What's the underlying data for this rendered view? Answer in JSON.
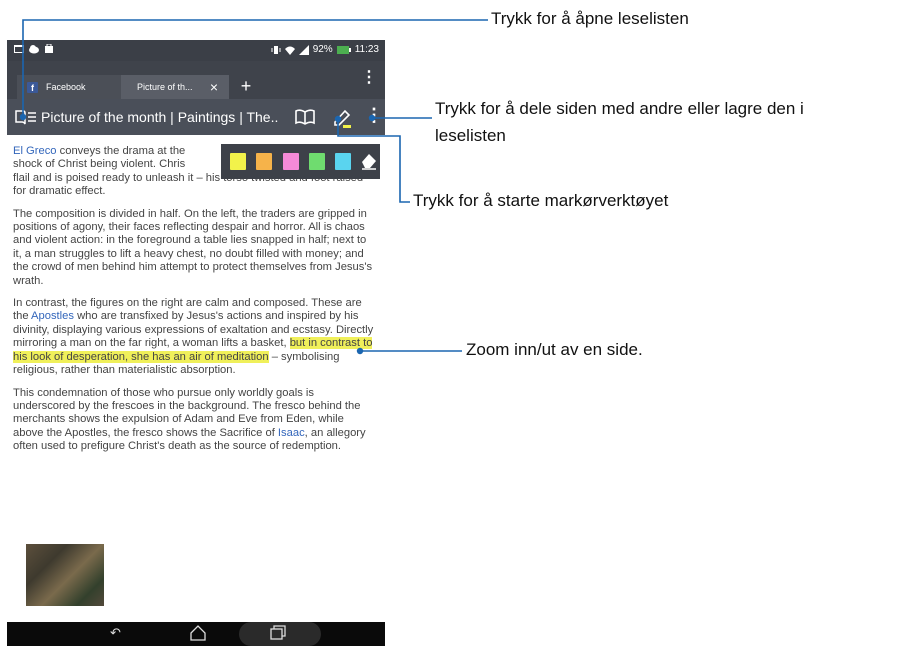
{
  "status": {
    "battery": "92%",
    "time": "11:23"
  },
  "tabs": [
    {
      "label": "Facebook",
      "icon": "f"
    },
    {
      "label": "Picture of th..."
    }
  ],
  "newtab_label": "+",
  "toolbar": {
    "title": "Picture of the month | Paintings | The...",
    "overflow": "⋮"
  },
  "article": {
    "p1a": "El Greco",
    "p1b": " conveys the drama at the ",
    "p1c": "shock of Christ being violent. Chris",
    "p1d": "flail and is poised ready to unleash it – his torso twisted and foot raised for dramatic effect.",
    "p2": "The composition is divided in half. On the left, the traders are gripped in positions of agony, their faces reflecting despair and horror. All is chaos and violent action: in the foreground a table lies snapped in half; next to it, a man struggles to lift a heavy chest, no doubt filled with money; and the crowd of men behind him attempt to protect themselves from Jesus's wrath.",
    "p3a": "In contrast, the figures on the right are calm and composed. These are the ",
    "p3b": "Apostles",
    "p3c": " who are transfixed by Jesus's actions and inspired by his divinity, displaying various expressions of exaltation and ecstasy. Directly mirroring a man on the far right, a woman lifts a basket, ",
    "p3d": "but in contrast to his look of desperation, she has an air of meditation",
    "p3e": " – symbolising religious, rather than materialistic absorption.",
    "p4a": "This condemnation of those who pursue only worldly goals is underscored by the frescoes in the background. The fresco behind the merchants shows the expulsion of Adam and Eve from Eden, while above the Apostles, the fresco shows the Sacrifice of ",
    "p4b": "Isaac",
    "p4c": ", an allegory often used to prefigure Christ's death as the source of redemption."
  },
  "palette_colors": [
    "#f2f24a",
    "#f6b34a",
    "#f58ad8",
    "#6fdc6f",
    "#5ad4ef"
  ],
  "callouts": {
    "reading_list": "Trykk for å åpne leselisten",
    "share_line1": "Trykk for å dele siden med andre eller lagre den i",
    "share_line2": "leselisten",
    "marker": "Trykk for å starte markørverktøyet",
    "zoom": "Zoom inn/ut av en side."
  },
  "colors": {
    "accent": "#1b66b0",
    "toolbar": "#4a4f59",
    "link": "#3366bb",
    "highlight": "#f0f05a"
  }
}
